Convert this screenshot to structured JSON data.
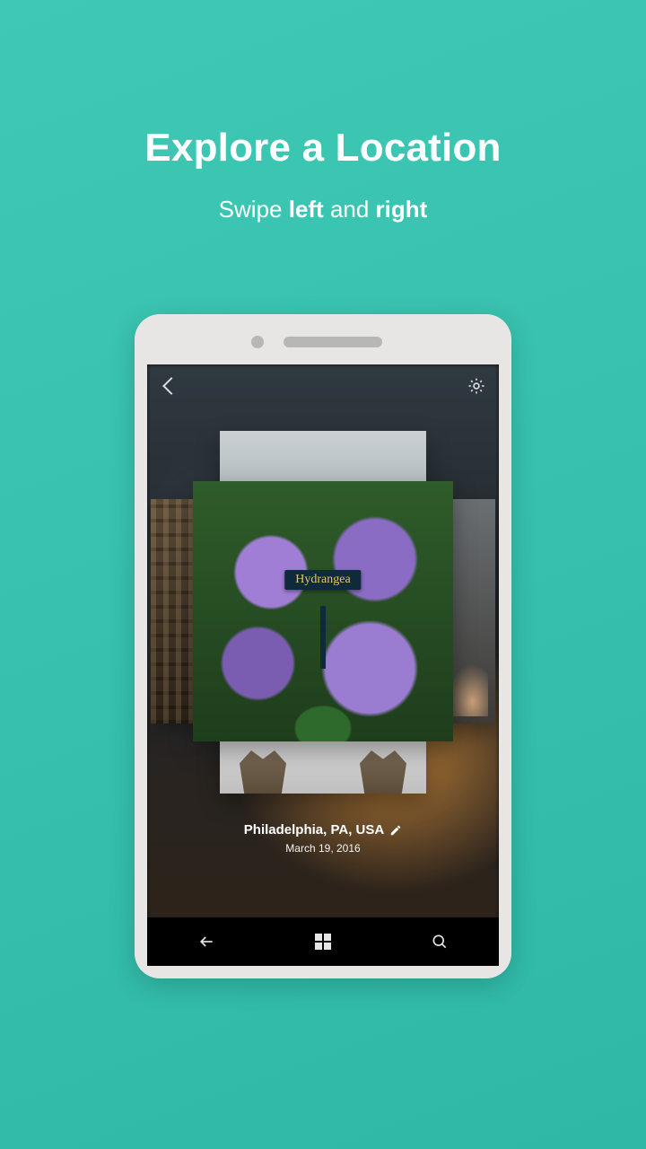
{
  "hero": {
    "title": "Explore a Location",
    "subtitle_pre": "Swipe ",
    "subtitle_b1": "left",
    "subtitle_mid": " and ",
    "subtitle_b2": "right"
  },
  "photo": {
    "plant_label": "Hydrangea"
  },
  "meta": {
    "location": "Philadelphia, PA, USA",
    "date": "March 19, 2016"
  }
}
